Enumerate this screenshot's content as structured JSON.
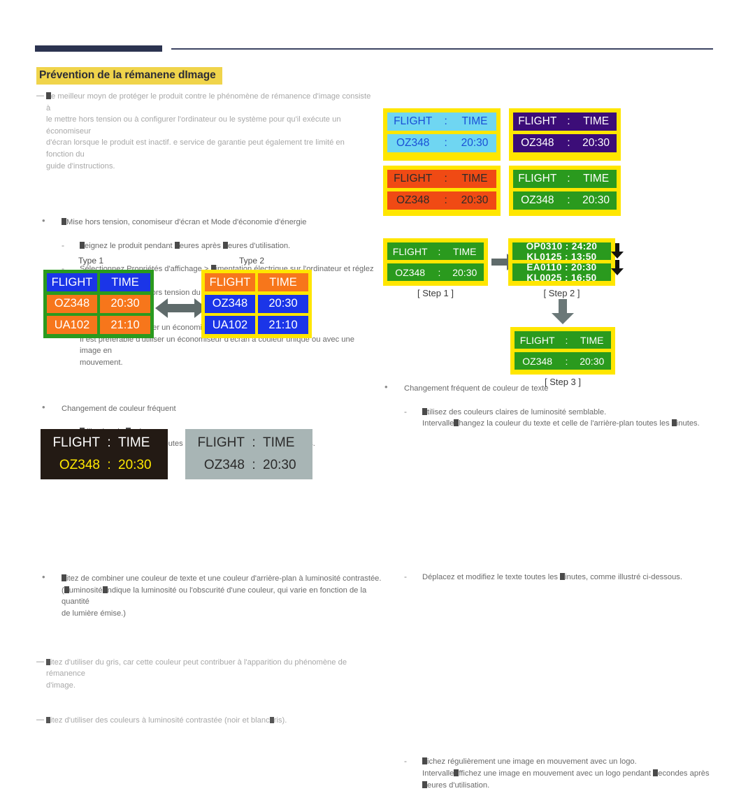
{
  "title": "Prévention de la rémanene dImage",
  "left_column": {
    "intro": {
      "marker": "—",
      "lines": [
        "e meilleur moyn de protéger le produit contre le phénomène de rémanence d'image consiste à",
        "le mettre hors tension ou à configurer l'ordinateur ou le système pour qu'il exécute un économiseur",
        "d'écran lorsque le produit est inactif. e service de garantie peut également tre limité en fonction du",
        "guide d'instructions."
      ]
    },
    "bullet1": {
      "marker": "•",
      "text": "Mise hors tension, conomiseur d'écran et Mode d'économie d'énergie",
      "sub": [
        {
          "marker": "-",
          "lines": [
            "eignez le produit pendant  eures après  eures d'utilisation."
          ]
        },
        {
          "marker": "-",
          "lines": [
            "Sélectionnez Propriétés d'affichage >  imentation électrique sur l'ordinateur et réglez le",
            "paramètre de mise hors tension du produit."
          ]
        },
        {
          "marker": "-",
          "lines": [
            "Il est conseillé d'utiliser un économiseur d'écran.",
            "Il est préférable d'utiliser un économiseur d'écran à couleur unique ou avec une image en",
            "mouvement."
          ]
        }
      ]
    },
    "bullet2": {
      "marker": "•",
      "text": "Changement de couleur fréquent",
      "sub": [
        {
          "marker": "-",
          "lines": [
            "tilisation de  ouleurs",
            "sculez entre  ouleurs toutes les  inutes, comme illustré ci-dessus."
          ]
        }
      ]
    },
    "type1_label": "Type 1",
    "type2_label": "Type 2",
    "table_rows": [
      {
        "left": "FLIGHT",
        "right": "TIME"
      },
      {
        "left": "OZ348",
        "right": "20:30"
      },
      {
        "left": "UA102",
        "right": "21:10"
      }
    ],
    "bullet3": {
      "marker": "•",
      "lines": [
        "itez de combiner une couleur de texte et une couleur d'arrière-plan à luminosité contrastée.",
        "(uminosité ndique la luminosité ou l'obscurité d'une couleur, qui varie en fonction de la quantité",
        "de lumière émise.)"
      ]
    },
    "note1": {
      "marker": "—",
      "lines": [
        "itez d'utiliser du gris, car cette couleur peut contribuer à l'apparition du phénomène de rémanence",
        "d'image."
      ]
    },
    "note2": {
      "marker": "—",
      "lines": [
        "itez d'utiliser des couleurs à luminosité contrastée (noir et blanc ris)."
      ]
    },
    "contrast_boards": [
      {
        "background": "#231a14",
        "head_color": "#ffffff",
        "value_color": "#ffe800",
        "head_a": "FLIGHT",
        "head_sep": ":",
        "head_b": "TIME",
        "val_a": "OZ348",
        "val_sep": ":",
        "val_b": "20:30"
      },
      {
        "background": "#a8b5b5",
        "head_color": "#2b2b2b",
        "value_color": "#2b2b2b",
        "head_a": "FLIGHT",
        "head_sep": ":",
        "head_b": "TIME",
        "val_a": "OZ348",
        "val_sep": ":",
        "val_b": "20:30"
      }
    ]
  },
  "right_column": {
    "bullet1": {
      "marker": "•",
      "text": "Changement fréquent de couleur de texte",
      "sub": [
        {
          "marker": "-",
          "lines": [
            "tilisez des couleurs claires de luminosité semblable.",
            "Intervalle hangez la couleur du texte et celle de l'arrière-plan toutes les  inutes."
          ]
        }
      ]
    },
    "color_boards": [
      {
        "frame": "#ffe600",
        "background": "#6fd6f2",
        "text_color": "#1a4fd6",
        "head_a": "FLIGHT",
        "head_sep": ":",
        "head_b": "TIME",
        "val_a": "OZ348",
        "val_sep": ":",
        "val_b": "20:30"
      },
      {
        "frame": "#ffe600",
        "background": "#3c0d78",
        "text_color": "#ffffff",
        "head_a": "FLIGHT",
        "head_sep": ":",
        "head_b": "TIME",
        "val_a": "OZ348",
        "val_sep": ":",
        "val_b": "20:30"
      },
      {
        "frame": "#ffe600",
        "background": "#f04a14",
        "text_color": "#2b2b2b",
        "head_a": "FLIGHT",
        "head_sep": ":",
        "head_b": "TIME",
        "val_a": "OZ348",
        "val_sep": ":",
        "val_b": "20:30"
      },
      {
        "frame": "#ffe600",
        "background": "#2a9a1e",
        "text_color": "#ffffff",
        "head_a": "FLIGHT",
        "head_sep": ":",
        "head_b": "TIME",
        "val_a": "OZ348",
        "val_sep": ":",
        "val_b": "20:30"
      }
    ],
    "bullet2": {
      "marker": "-",
      "lines": [
        "Déplacez et modifiez le texte toutes les  inutes, comme illustré ci-dessous."
      ]
    },
    "step1": {
      "caption": "[ Step 1 ]",
      "head_a": "FLIGHT",
      "head_sep": ":",
      "head_b": "TIME",
      "val_a": "OZ348",
      "val_sep": ":",
      "val_b": "20:30"
    },
    "step2": {
      "caption": "[ Step 2 ]",
      "row1_line1": "OP0310  :  24:20",
      "row1_line2": "KL0125  :  13:50",
      "row2_line1": "EA0110  :  20:30",
      "row2_line2": "KL0025  :  16:50"
    },
    "step3": {
      "caption": "[ Step 3 ]",
      "head_a": "FLIGHT",
      "head_sep": ":",
      "head_b": "TIME",
      "val_a": "OZ348",
      "val_sep": ":",
      "val_b": "20:30"
    },
    "bullet3": {
      "marker": "-",
      "lines": [
        "ichez régulièrement une image en mouvement avec un logo.",
        "Intervalle ffichez une image en mouvement avec un logo pendant  econdes après",
        "eures d'utilisation."
      ]
    }
  },
  "colors": {
    "rule": "#2b3350",
    "title_highlight": "#f0d44b",
    "green_frame": "#2a9a1e",
    "yellow_frame": "#ffe600",
    "blue_cell": "#1b35e8",
    "orange_cell": "#f7761b",
    "arrow_gray": "#5f6b6b"
  }
}
